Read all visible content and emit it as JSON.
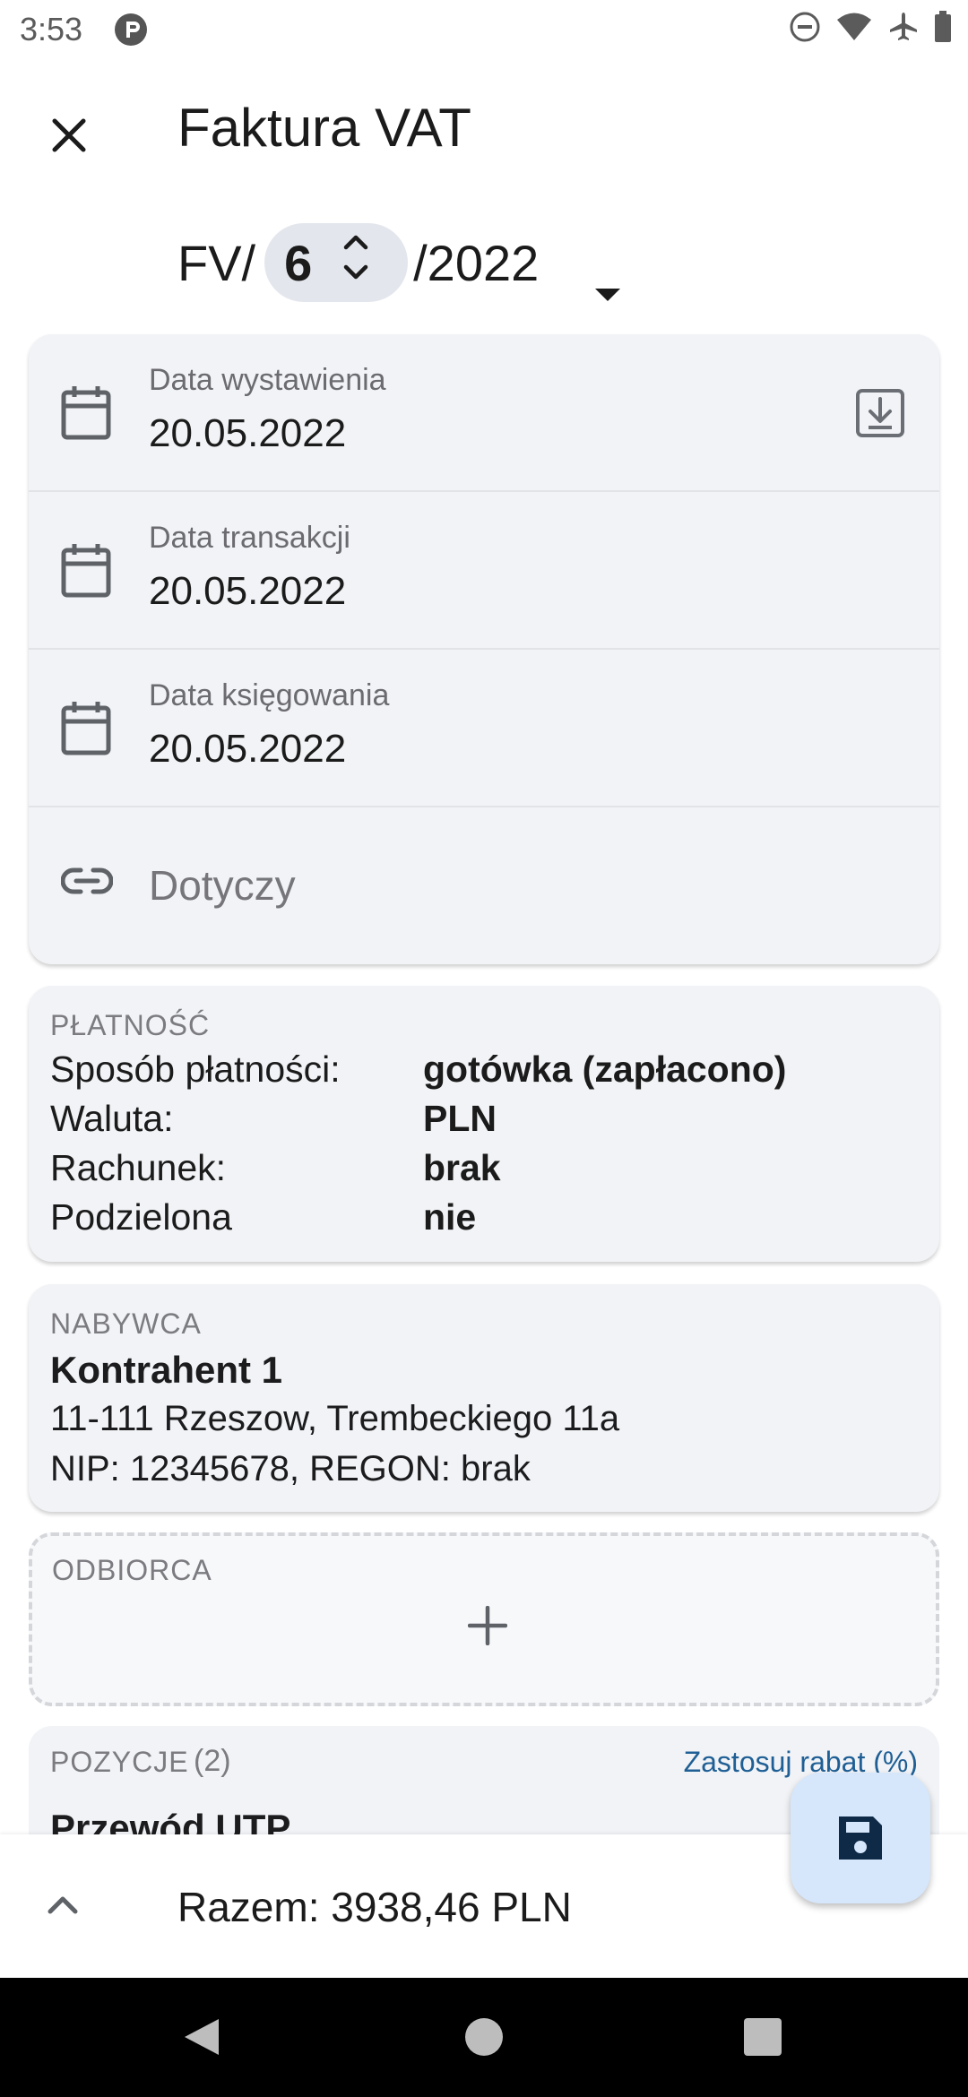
{
  "status_bar": {
    "time": "3:53",
    "icons": [
      "app-notification-icon",
      "do-not-disturb-icon",
      "wifi-icon",
      "airplane-icon",
      "battery-icon"
    ]
  },
  "app_bar": {
    "close_icon": "close-icon",
    "title": "Faktura VAT"
  },
  "invoice_number": {
    "prefix": "FV/",
    "number": "6",
    "suffix": "/2022"
  },
  "dates": [
    {
      "label": "Data wystawienia",
      "value": "20.05.2022"
    },
    {
      "label": "Data transakcji",
      "value": "20.05.2022"
    },
    {
      "label": "Data księgowania",
      "value": "20.05.2022"
    }
  ],
  "related": {
    "placeholder": "Dotyczy"
  },
  "payment": {
    "section_label": "PŁATNOŚĆ",
    "rows": [
      {
        "key": "Sposób płatności:",
        "value": "gotówka (zapłacono)"
      },
      {
        "key": "Waluta:",
        "value": "PLN"
      },
      {
        "key": "Rachunek:",
        "value": "brak"
      },
      {
        "key": "Podzielona",
        "value": "nie"
      }
    ]
  },
  "buyer": {
    "section_label": "NABYWCA",
    "name": "Kontrahent 1",
    "address": "11-111 Rzeszow, Trembeckiego 11a",
    "ids": "NIP: 12345678, REGON: brak"
  },
  "receiver": {
    "section_label": "ODBIORCA"
  },
  "positions": {
    "section_label": "POZYCJE",
    "count": "(2)",
    "discount_link": "Zastosuj rabat (%)",
    "first_item": "Przewód UTP"
  },
  "summary": {
    "total": "Razem: 3938,46 PLN"
  },
  "colors": {
    "card_bg": "#f1f3f6",
    "fab_bg": "#d6e6fb",
    "link": "#1f5f95",
    "icon": "#5f6368"
  }
}
